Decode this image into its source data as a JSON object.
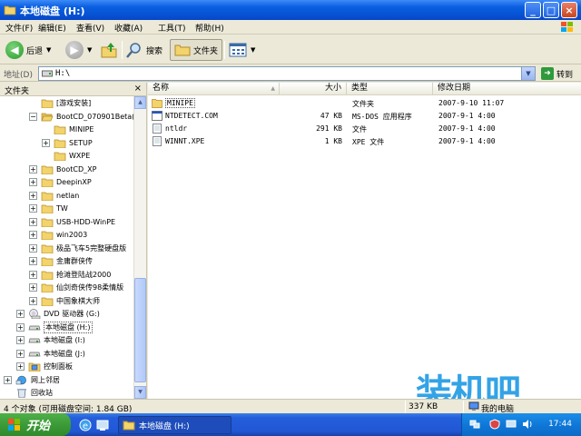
{
  "window": {
    "title": "本地磁盘 (H:)",
    "min_label": "_",
    "max_label": "□",
    "close_label": "×"
  },
  "menu": [
    "文件(F)",
    "编辑(E)",
    "查看(V)",
    "收藏(A)",
    "工具(T)",
    "帮助(H)"
  ],
  "toolbar": {
    "back_label": "后退",
    "search_label": "搜索",
    "folders_label": "文件夹"
  },
  "address": {
    "label": "地址(D)",
    "value": "H:\\",
    "go_label": "转到"
  },
  "folders_pane": {
    "title": "文件夹",
    "close_label": "×",
    "tree": [
      {
        "label": "[游戏安装]",
        "indent": 2,
        "expander": "none",
        "icon": "folder"
      },
      {
        "label": "BootCD_070901Beta(",
        "indent": 2,
        "expander": "minus",
        "icon": "folder-open"
      },
      {
        "label": "MINIPE",
        "indent": 3,
        "expander": "none",
        "icon": "folder"
      },
      {
        "label": "SETUP",
        "indent": 3,
        "expander": "plus",
        "icon": "folder"
      },
      {
        "label": "WXPE",
        "indent": 3,
        "expander": "none",
        "icon": "folder"
      },
      {
        "label": "BootCD_XP",
        "indent": 2,
        "expander": "plus",
        "icon": "folder"
      },
      {
        "label": "DeepinXP",
        "indent": 2,
        "expander": "plus",
        "icon": "folder"
      },
      {
        "label": "netlan",
        "indent": 2,
        "expander": "plus",
        "icon": "folder"
      },
      {
        "label": "TW",
        "indent": 2,
        "expander": "plus",
        "icon": "folder"
      },
      {
        "label": "USB-HDD-WinPE",
        "indent": 2,
        "expander": "plus",
        "icon": "folder"
      },
      {
        "label": "win2003",
        "indent": 2,
        "expander": "plus",
        "icon": "folder"
      },
      {
        "label": "极品飞车5完整硬盘版",
        "indent": 2,
        "expander": "plus",
        "icon": "folder"
      },
      {
        "label": "金庸群侠传",
        "indent": 2,
        "expander": "plus",
        "icon": "folder"
      },
      {
        "label": "抢滩登陆战2000",
        "indent": 2,
        "expander": "plus",
        "icon": "folder"
      },
      {
        "label": "仙剑奇侠传98柔情版",
        "indent": 2,
        "expander": "plus",
        "icon": "folder"
      },
      {
        "label": "中国象棋大师",
        "indent": 2,
        "expander": "plus",
        "icon": "folder"
      },
      {
        "label": "DVD 驱动器 (G:)",
        "indent": 1,
        "expander": "plus",
        "icon": "dvd"
      },
      {
        "label": "本地磁盘 (H:)",
        "indent": 1,
        "expander": "plus",
        "icon": "drive",
        "selected": true
      },
      {
        "label": "本地磁盘 (I:)",
        "indent": 1,
        "expander": "plus",
        "icon": "drive"
      },
      {
        "label": "本地磁盘 (J:)",
        "indent": 1,
        "expander": "plus",
        "icon": "drive"
      },
      {
        "label": "控制面板",
        "indent": 1,
        "expander": "plus",
        "icon": "control-panel"
      },
      {
        "label": "网上邻居",
        "indent": 0,
        "expander": "plus",
        "icon": "network"
      },
      {
        "label": "回收站",
        "indent": 0,
        "expander": "none",
        "icon": "recycle"
      }
    ]
  },
  "filelist": {
    "columns": {
      "name": "名称",
      "size": "大小",
      "type": "类型",
      "modified": "修改日期"
    },
    "sort_indicator": "▲",
    "rows": [
      {
        "name": "MINIPE",
        "size": "",
        "type": "文件夹",
        "modified": "2007-9-10 11:07",
        "icon": "folder",
        "selected": true
      },
      {
        "name": "NTDETECT.COM",
        "size": "47 KB",
        "type": "MS-DOS 应用程序",
        "modified": "2007-9-1 4:00",
        "icon": "exe"
      },
      {
        "name": "ntldr",
        "size": "291 KB",
        "type": "文件",
        "modified": "2007-9-1 4:00",
        "icon": "file"
      },
      {
        "name": "WINNT.XPE",
        "size": "1 KB",
        "type": "XPE 文件",
        "modified": "2007-9-1 4:00",
        "icon": "file"
      }
    ]
  },
  "status": {
    "objects": "4 个对象 (可用磁盘空间: 1.84 GB)",
    "size": "337 KB",
    "location": "我的电脑"
  },
  "watermark": "装机吧",
  "taskbar": {
    "start_label": "开始",
    "task_title": "本地磁盘 (H:)",
    "clock": "17:44"
  },
  "colors": {
    "title_blue": "#0654d6",
    "taskbar_blue": "#245edb",
    "start_green": "#3c9a37",
    "folder_yellow": "#f3d36b",
    "watermark_blue": "#33a3e6"
  }
}
